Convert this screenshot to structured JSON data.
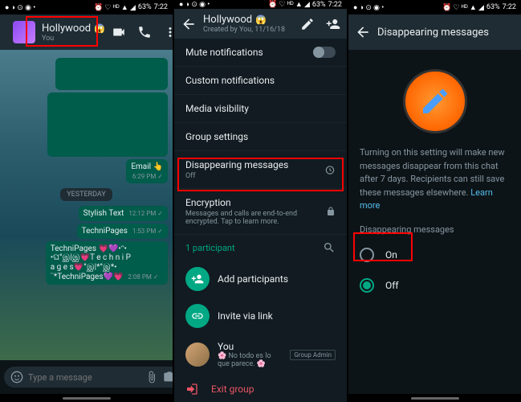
{
  "status": {
    "time": "7:22",
    "battery": "63%"
  },
  "s1": {
    "title": "Hollywood",
    "subtitle": "You",
    "emoji": "😱",
    "msgs": {
      "email": "Email 👆",
      "email_time": "6:29 PM ✓",
      "date": "YESTERDAY",
      "stylish": "Stylish Text",
      "stylish_time": "12:12 PM ✓",
      "tp1": "TechniPages",
      "tp1_time": "1:53 PM ✓",
      "tp2": "TechniPages 💗💜•ᵔ•",
      "tp2_time": "",
      "tp3": "•ଘ°இ|இ💗T e c h n i P",
      "tp3_time": "",
      "tp4": "a g e s💗°இ|*°இ*•",
      "tp4_time": "",
      "tp5": "¨*TechniPages💜💗",
      "tp5_time": "2:08 PM ✓"
    },
    "input_placeholder": "Type a message"
  },
  "s2": {
    "title": "Hollywood",
    "subtitle": "Created by You, 11/16/18",
    "emoji": "😱",
    "items": {
      "mute": "Mute notifications",
      "custom": "Custom notifications",
      "media": "Media visibility",
      "group": "Group settings",
      "dm": "Disappearing messages",
      "dm_sub": "Off",
      "enc": "Encryption",
      "enc_sub": "Messages and calls are end-to-end encrypted. Tap to learn more."
    },
    "participants": {
      "header": "1 participant",
      "add": "Add participants",
      "invite": "Invite via link",
      "you": "You",
      "you_status": "🌸 No todo es lo que parece. 🌸",
      "badge": "Group Admin"
    },
    "exit": "Exit group"
  },
  "s3": {
    "title": "Disappearing messages",
    "desc": "Turning on this setting will make new messages disappear from this chat after 7 days. Recipients can still save these messages elsewhere.",
    "learn": "Learn more",
    "section": "Disappearing messages",
    "on": "On",
    "off": "Off"
  }
}
